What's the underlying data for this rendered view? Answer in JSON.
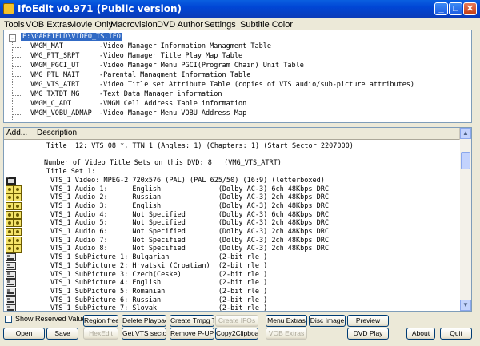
{
  "window": {
    "title": "IfoEdit v0.971 (Public version)",
    "minimize": "_",
    "maximize": "□",
    "close": "✕"
  },
  "menu": [
    "Tools",
    "VOB Extras",
    "Movie Only",
    "Macrovision",
    "DVD Author",
    "Settings",
    "Subtitle Color"
  ],
  "tree": {
    "expander": "-",
    "root": "E:\\GARFIELD\\VIDEO_TS.IFO",
    "items": [
      {
        "code": "VMGM_MAT",
        "desc": "-Video Manager Information Managment Table"
      },
      {
        "code": "VMG_PTT_SRPT",
        "desc": "-Video Manager Title Play Map Table"
      },
      {
        "code": "VMGM_PGCI_UT",
        "desc": "-Video Manager Menu PGCI(Program Chain) Unit Table"
      },
      {
        "code": "VMG_PTL_MAIT",
        "desc": "-Parental Managment Information Table"
      },
      {
        "code": "VMG_VTS_ATRT",
        "desc": "-Video Title set Attribute Table (copies of VTS audio/sub-picture attributes)"
      },
      {
        "code": "VMG_TXTDT_MG",
        "desc": "-Text Data Manager information"
      },
      {
        "code": "VMGM_C_ADT",
        "desc": "-VMGM Cell Address Table information"
      },
      {
        "code": "VMGM_VOBU_ADMAP",
        "desc": "-Video Manager Menu VOBU Address Map"
      }
    ]
  },
  "list": {
    "columns": [
      "Add...",
      "Description"
    ],
    "rows": [
      {
        "text": "Title  12: VTS_08_*, TTN_1 (Angles: 1) (Chapters: 1) (Start Sector 2207000)",
        "indent": 1,
        "icon": ""
      },
      {
        "text": "",
        "indent": 0,
        "icon": ""
      },
      {
        "text": "Number of Video Title Sets on this DVD: 8   (VMG_VTS_ATRT)",
        "indent": 2,
        "icon": ""
      },
      {
        "text": "Title Set 1:",
        "indent": 3,
        "icon": ""
      },
      {
        "text": "VTS_1 Video: MPEG-2 720x576 (PAL) (PAL 625/50) (16:9) (letterboxed)",
        "indent": 4,
        "icon": "film"
      },
      {
        "text": "VTS_1 Audio 1:      English              (Dolby AC-3) 6ch 48Kbps DRC",
        "indent": 4,
        "icon": "audio"
      },
      {
        "text": "VTS_1 Audio 2:      Russian              (Dolby AC-3) 2ch 48Kbps DRC",
        "indent": 4,
        "icon": "audio"
      },
      {
        "text": "VTS_1 Audio 3:      English              (Dolby AC-3) 2ch 48Kbps DRC",
        "indent": 4,
        "icon": "audio"
      },
      {
        "text": "VTS_1 Audio 4:      Not Specified        (Dolby AC-3) 6ch 48Kbps DRC",
        "indent": 4,
        "icon": "audio"
      },
      {
        "text": "VTS_1 Audio 5:      Not Specified        (Dolby AC-3) 2ch 48Kbps DRC",
        "indent": 4,
        "icon": "audio"
      },
      {
        "text": "VTS_1 Audio 6:      Not Specified        (Dolby AC-3) 2ch 48Kbps DRC",
        "indent": 4,
        "icon": "audio"
      },
      {
        "text": "VTS_1 Audio 7:      Not Specified        (Dolby AC-3) 2ch 48Kbps DRC",
        "indent": 4,
        "icon": "audio"
      },
      {
        "text": "VTS_1 Audio 8:      Not Specified        (Dolby AC-3) 2ch 48Kbps DRC",
        "indent": 4,
        "icon": "audio"
      },
      {
        "text": "VTS_1 SubPicture 1: Bulgarian            (2-bit rle )",
        "indent": 4,
        "icon": "sub"
      },
      {
        "text": "VTS_1 SubPicture 2: Hrvatski (Croatian)  (2-bit rle )",
        "indent": 4,
        "icon": "sub"
      },
      {
        "text": "VTS_1 SubPicture 3: Czech(Ceske)         (2-bit rle )",
        "indent": 4,
        "icon": "sub"
      },
      {
        "text": "VTS_1 SubPicture 4: English              (2-bit rle )",
        "indent": 4,
        "icon": "sub"
      },
      {
        "text": "VTS_1 SubPicture 5: Romanian             (2-bit rle )",
        "indent": 4,
        "icon": "sub"
      },
      {
        "text": "VTS_1 SubPicture 6: Russian              (2-bit rle )",
        "indent": 4,
        "icon": "sub"
      },
      {
        "text": "VTS_1 SubPicture 7: Slovak               (2-bit rle )",
        "indent": 4,
        "icon": "sub"
      }
    ]
  },
  "scroll": {
    "up": "▲",
    "down": "▼"
  },
  "bottom": {
    "show_reserved": "Show Reserved Values",
    "buttons_row1": [
      {
        "label": "Region free",
        "disabled": false
      },
      {
        "label": "Delete Playback",
        "disabled": false
      },
      {
        "label": "Create Tmpg T.",
        "disabled": false
      },
      {
        "label": "Create IFOs",
        "disabled": true
      },
      {
        "label": "Menu Extras",
        "disabled": false
      },
      {
        "label": "Disc Image",
        "disabled": false
      },
      {
        "label": "Preview",
        "disabled": false
      }
    ],
    "buttons_row2": [
      {
        "label": "Open",
        "disabled": false
      },
      {
        "label": "Save",
        "disabled": false
      },
      {
        "label": "HexEdit",
        "disabled": true
      },
      {
        "label": "Get VTS sectors",
        "disabled": false
      },
      {
        "label": "Remove P-UPs",
        "disabled": false
      },
      {
        "label": "Copy2Clipboard",
        "disabled": false
      },
      {
        "label": "VOB Extras",
        "disabled": true
      },
      {
        "label": "DVD Play",
        "disabled": false
      },
      {
        "label": "About",
        "disabled": false
      },
      {
        "label": "Quit",
        "disabled": false
      }
    ]
  },
  "colors": {
    "titlebar": "#0054e3",
    "selection": "#316ac5",
    "window_bg": "#ece9d8"
  }
}
